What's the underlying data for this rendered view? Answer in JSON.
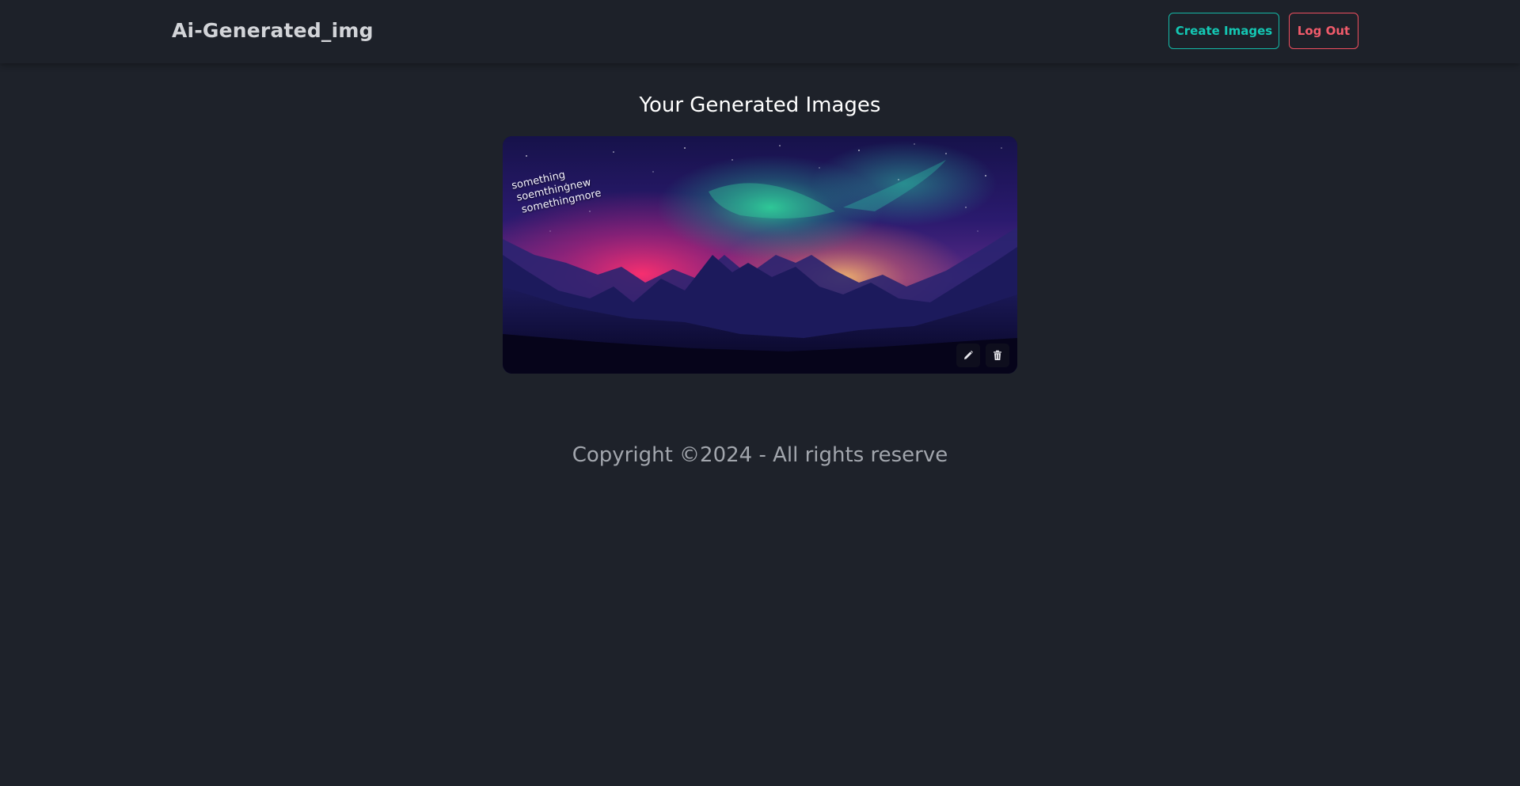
{
  "header": {
    "brand": "Ai-Generated_img",
    "create_label": "Create Images",
    "logout_label": "Log Out"
  },
  "main": {
    "title": "Your Generated Images",
    "images": [
      {
        "caption_lines": [
          "something",
          "soemthingnew",
          "somethingmore"
        ],
        "actions": [
          "pencil-icon",
          "trash-icon"
        ]
      }
    ]
  },
  "footer": {
    "copyright": "Copyright ©2024 - All rights reserve"
  },
  "colors": {
    "background": "#1e222a",
    "navbar": "#1d2129",
    "create_accent": "#14b8a6",
    "logout_accent": "#ef4f5f"
  }
}
